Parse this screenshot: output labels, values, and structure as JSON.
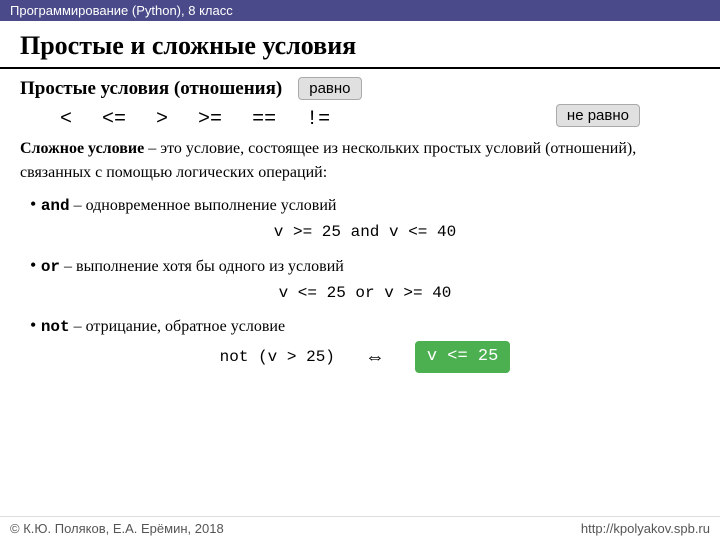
{
  "topBar": {
    "text": "Программирование (Python), 8 класс"
  },
  "pageTitle": "Простые и сложные условия",
  "sectionHeader": "Простые условия (отношения)",
  "badgeEqual": "равно",
  "badgeNotEqual": "не равно",
  "operators": [
    "<",
    "<=",
    ">",
    ">=",
    "==",
    "!="
  ],
  "complexDef": {
    "boldPart": "Сложное условие",
    "rest": " – это условие, состоящее из нескольких простых условий (отношений), связанных с помощью логических операций:"
  },
  "bullets": [
    {
      "keyword": "and",
      "desc": " – одновременное выполнение условий",
      "code": "v >= 25 and v <= 40"
    },
    {
      "keyword": "or",
      "desc": " – выполнение хотя бы одного из условий",
      "code": "v <= 25 or v >= 40"
    },
    {
      "keyword": "not",
      "desc": " – отрицание, обратное условие",
      "code": "not (v > 25)",
      "arrow": "⟺",
      "badge": "v <= 25"
    }
  ],
  "footer": {
    "left": "© К.Ю. Поляков, Е.А. Ерёмин, 2018",
    "right": "http://kpolyakov.spb.ru"
  }
}
